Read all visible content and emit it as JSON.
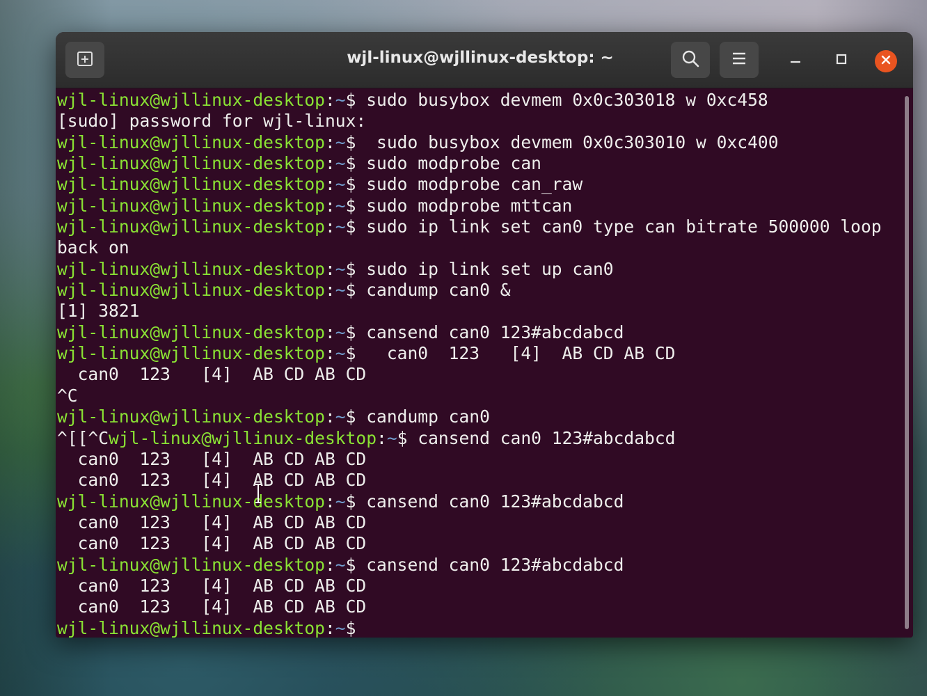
{
  "window": {
    "title": "wjl-linux@wjllinux-desktop: ~"
  },
  "icons": {
    "new_tab": "new-tab-icon",
    "search": "search-icon",
    "menu": "hamburger-menu-icon",
    "minimize": "minimize-icon",
    "maximize": "maximize-icon",
    "close": "close-icon"
  },
  "colors": {
    "terminal_bg": "#300a24",
    "prompt_user": "#8ae234",
    "prompt_path": "#729fcf",
    "text": "#eeeeec",
    "close_button": "#e95420"
  },
  "prompt": {
    "user_host": "wjl-linux@wjllinux-desktop",
    "colon": ":",
    "path": "~",
    "symbol": "$"
  },
  "terminal": {
    "lines": [
      {
        "type": "cmd",
        "cmd": " sudo busybox devmem 0x0c303018 w 0xc458"
      },
      {
        "type": "out",
        "text": "[sudo] password for wjl-linux:"
      },
      {
        "type": "cmd",
        "cmd": "  sudo busybox devmem 0x0c303010 w 0xc400"
      },
      {
        "type": "cmd",
        "cmd": " sudo modprobe can"
      },
      {
        "type": "cmd",
        "cmd": " sudo modprobe can_raw"
      },
      {
        "type": "cmd",
        "cmd": " sudo modprobe mttcan"
      },
      {
        "type": "cmd",
        "cmd": " sudo ip link set can0 type can bitrate 500000 loop"
      },
      {
        "type": "out",
        "text": "back on"
      },
      {
        "type": "cmd",
        "cmd": " sudo ip link set up can0"
      },
      {
        "type": "cmd",
        "cmd": " candump can0 &"
      },
      {
        "type": "out",
        "text": "[1] 3821"
      },
      {
        "type": "cmd",
        "cmd": " cansend can0 123#abcdabcd"
      },
      {
        "type": "cmd",
        "cmd": "   can0  123   [4]  AB CD AB CD"
      },
      {
        "type": "out",
        "text": "  can0  123   [4]  AB CD AB CD"
      },
      {
        "type": "out",
        "text": "^C"
      },
      {
        "type": "cmd",
        "cmd": " candump can0"
      },
      {
        "type": "cmd",
        "pre": "^[[^C",
        "cmd": " cansend can0 123#abcdabcd"
      },
      {
        "type": "out",
        "text": "  can0  123   [4]  AB CD AB CD"
      },
      {
        "type": "out",
        "text": "  can0  123   [4]  AB CD AB CD"
      },
      {
        "type": "cmd",
        "cmd": " cansend can0 123#abcdabcd"
      },
      {
        "type": "out",
        "text": "  can0  123   [4]  AB CD AB CD"
      },
      {
        "type": "out",
        "text": "  can0  123   [4]  AB CD AB CD"
      },
      {
        "type": "cmd",
        "cmd": " cansend can0 123#abcdabcd"
      },
      {
        "type": "out",
        "text": "  can0  123   [4]  AB CD AB CD"
      },
      {
        "type": "out",
        "text": "  can0  123   [4]  AB CD AB CD"
      },
      {
        "type": "cmd",
        "cmd": ""
      }
    ]
  }
}
